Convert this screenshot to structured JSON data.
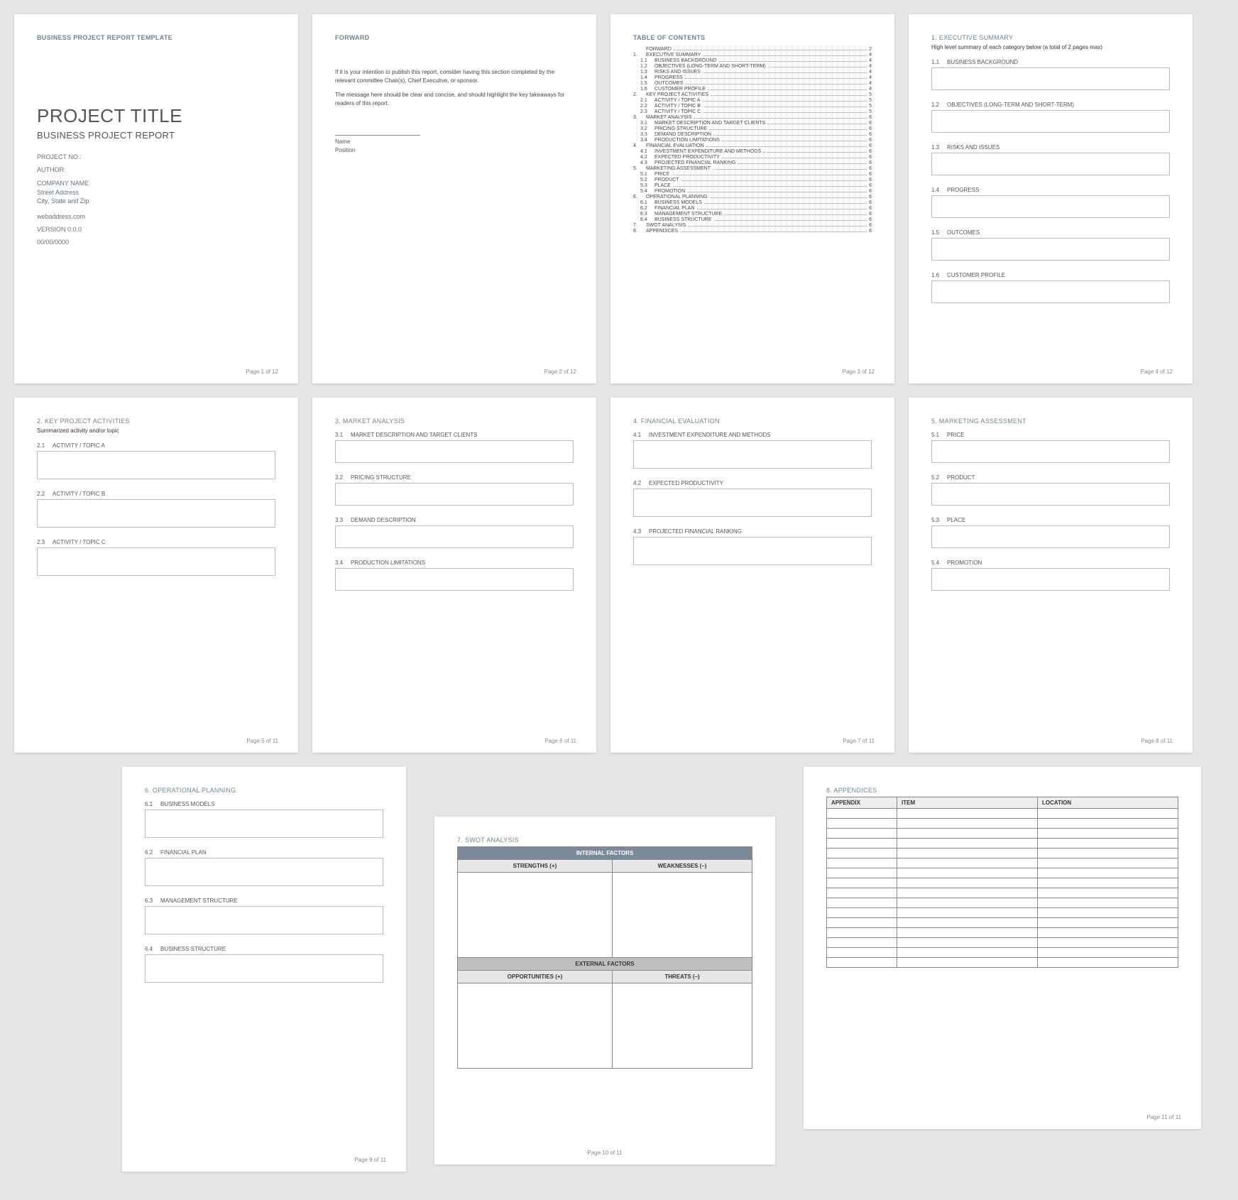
{
  "page1": {
    "header": "BUSINESS PROJECT REPORT TEMPLATE",
    "title": "PROJECT TITLE",
    "subtitle": "BUSINESS PROJECT REPORT",
    "project_no": "PROJECT NO.:",
    "author": "AUTHOR:",
    "company": "COMPANY NAME",
    "street": "Street Address",
    "citystate": "City, State and Zip",
    "web": "webaddress.com",
    "version": "VERSION 0.0.0",
    "date": "00/00/0000",
    "pgnum": "Page 1 of 12"
  },
  "page2": {
    "title": "FORWARD",
    "p1": "If it is your intention to publish this report, consider having this section completed by the relevant committee Chair(s), Chief Executive, or sponsor.",
    "p2": "The message here should be clear and concise, and should highlight the key takeaways for readers of this report.",
    "name": "Name",
    "position": "Position",
    "pgnum": "Page 2 of 12"
  },
  "page3": {
    "title": "TABLE OF CONTENTS",
    "items": [
      {
        "n": "",
        "t": "FORWARD",
        "p": "2"
      },
      {
        "n": "1.",
        "t": "EXECUTIVE SUMMARY",
        "p": "4"
      },
      {
        "n": "1.1",
        "t": "BUSINESS BACKGROUND",
        "p": "4",
        "i": true
      },
      {
        "n": "1.2",
        "t": "OBJECTIVES (LONG-TERM AND SHORT-TERM)",
        "p": "4",
        "i": true
      },
      {
        "n": "1.3",
        "t": "RISKS AND ISSUES",
        "p": "4",
        "i": true
      },
      {
        "n": "1.4",
        "t": "PROGRESS",
        "p": "4",
        "i": true
      },
      {
        "n": "1.5",
        "t": "OUTCOMES",
        "p": "4",
        "i": true
      },
      {
        "n": "1.6",
        "t": "CUSTOMER PROFILE",
        "p": "4",
        "i": true
      },
      {
        "n": "2.",
        "t": "KEY PROJECT ACTIVITIES",
        "p": "5"
      },
      {
        "n": "2.1",
        "t": "ACTIVITY / TOPIC A",
        "p": "5",
        "i": true
      },
      {
        "n": "2.2",
        "t": "ACTIVITY / TOPIC B",
        "p": "5",
        "i": true
      },
      {
        "n": "2.3",
        "t": "ACTIVITY / TOPIC C",
        "p": "5",
        "i": true
      },
      {
        "n": "3.",
        "t": "MARKET ANALYSIS",
        "p": "6"
      },
      {
        "n": "3.1",
        "t": "MARKET DESCRIPTION AND TARGET CLIENTS",
        "p": "6",
        "i": true
      },
      {
        "n": "3.2",
        "t": "PRICING STRUCTURE",
        "p": "6",
        "i": true
      },
      {
        "n": "3.3",
        "t": "DEMAND DESCRIPTION",
        "p": "6",
        "i": true
      },
      {
        "n": "3.4",
        "t": "PRODUCTION LIMITATIONS",
        "p": "6",
        "i": true
      },
      {
        "n": "4.",
        "t": "FINANCIAL EVALUATION",
        "p": "6"
      },
      {
        "n": "4.1",
        "t": "INVESTMENT EXPENDITURE AND METHODS",
        "p": "6",
        "i": true
      },
      {
        "n": "4.2",
        "t": "EXPECTED PRODUCTIVITY",
        "p": "6",
        "i": true
      },
      {
        "n": "4.3",
        "t": "PROJECTED FINANCIAL RANKING",
        "p": "6",
        "i": true
      },
      {
        "n": "5.",
        "t": "MARKETING ASSESSMENT",
        "p": "6"
      },
      {
        "n": "5.1",
        "t": "PRICE",
        "p": "6",
        "i": true
      },
      {
        "n": "5.2",
        "t": "PRODUCT",
        "p": "6",
        "i": true
      },
      {
        "n": "5.3",
        "t": "PLACE",
        "p": "6",
        "i": true
      },
      {
        "n": "5.4",
        "t": "PROMOTION",
        "p": "6",
        "i": true
      },
      {
        "n": "6.",
        "t": "OPERATIONAL PLANNING",
        "p": "6"
      },
      {
        "n": "6.1",
        "t": "BUSINESS MODELS",
        "p": "6",
        "i": true
      },
      {
        "n": "6.2",
        "t": "FINANCIAL PLAN",
        "p": "6",
        "i": true
      },
      {
        "n": "6.3",
        "t": "MANAGEMENT STRUCTURE",
        "p": "6",
        "i": true
      },
      {
        "n": "6.4",
        "t": "BUSINESS STRUCTURE",
        "p": "6",
        "i": true
      },
      {
        "n": "7.",
        "t": "SWOT ANALYSIS",
        "p": "6"
      },
      {
        "n": "8.",
        "t": "APPENDICES",
        "p": "6"
      }
    ],
    "pgnum": "Page 3 of 12"
  },
  "page4": {
    "title": "1. EXECUTIVE SUMMARY",
    "note": "High level summary of each category below (a total of 2 pages max)",
    "s1n": "1.1",
    "s1": "BUSINESS BACKGROUND",
    "s2n": "1.2",
    "s2": "OBJECTIVES (LONG-TERM AND SHORT-TERM)",
    "s3n": "1.3",
    "s3": "RISKS AND ISSUES",
    "s4n": "1.4",
    "s4": "PROGRESS",
    "s5n": "1.5",
    "s5": "OUTCOMES",
    "s6n": "1.6",
    "s6": "CUSTOMER PROFILE",
    "pgnum": "Page 4 of 12"
  },
  "page5": {
    "title": "2. KEY PROJECT ACTIVITIES",
    "note": "Summarized activity and/or topic",
    "s1n": "2.1",
    "s1": "ACTIVITY / TOPIC A",
    "s2n": "2.2",
    "s2": "ACTIVITY / TOPIC B",
    "s3n": "2.3",
    "s3": "ACTIVITY / TOPIC C",
    "pgnum": "Page 5 of 11"
  },
  "page6": {
    "title": "3. MARKET ANALYSIS",
    "s1n": "3.1",
    "s1": "MARKET DESCRIPTION AND TARGET CLIENTS",
    "s2n": "3.2",
    "s2": "PRICING STRUCTURE",
    "s3n": "3.3",
    "s3": "DEMAND DESCRIPTION",
    "s4n": "3.4",
    "s4": "PRODUCTION LIMITATIONS",
    "pgnum": "Page 6 of 11"
  },
  "page7": {
    "title": "4. FINANCIAL EVALUATION",
    "s1n": "4.1",
    "s1": "INVESTMENT EXPENDITURE AND METHODS",
    "s2n": "4.2",
    "s2": "EXPECTED PRODUCTIVITY",
    "s3n": "4.3",
    "s3": "PROJECTED FINANCIAL RANKING",
    "pgnum": "Page 7 of 11"
  },
  "page8": {
    "title": "5. MARKETING ASSESSMENT",
    "s1n": "5.1",
    "s1": "PRICE",
    "s2n": "5.2",
    "s2": "PRODUCT",
    "s3n": "5.3",
    "s3": "PLACE",
    "s4n": "5.4",
    "s4": "PROMOTION",
    "pgnum": "Page 8 of 11"
  },
  "page9": {
    "title": "6. OPERATIONAL PLANNING",
    "s1n": "6.1",
    "s1": "BUSINESS MODELS",
    "s2n": "6.2",
    "s2": "FINANCIAL PLAN",
    "s3n": "6.3",
    "s3": "MANAGEMENT STRUCTURE",
    "s4n": "6.4",
    "s4": "BUSINESS STRUCTURE",
    "pgnum": "Page 9 of 11"
  },
  "page10": {
    "title": "7. SWOT ANALYSIS",
    "internal": "INTERNAL FACTORS",
    "external": "EXTERNAL FACTORS",
    "strengths": "STRENGTHS (+)",
    "weaknesses": "WEAKNESSES (–)",
    "opportunities": "OPPORTUNITIES (+)",
    "threats": "THREATS (–)",
    "pgnum": "Page 10 of 11"
  },
  "page11": {
    "title": "8. APPENDICES",
    "h1": "APPENDIX",
    "h2": "ITEM",
    "h3": "LOCATION",
    "rows": 16,
    "pgnum": "Page 11 of 11"
  }
}
